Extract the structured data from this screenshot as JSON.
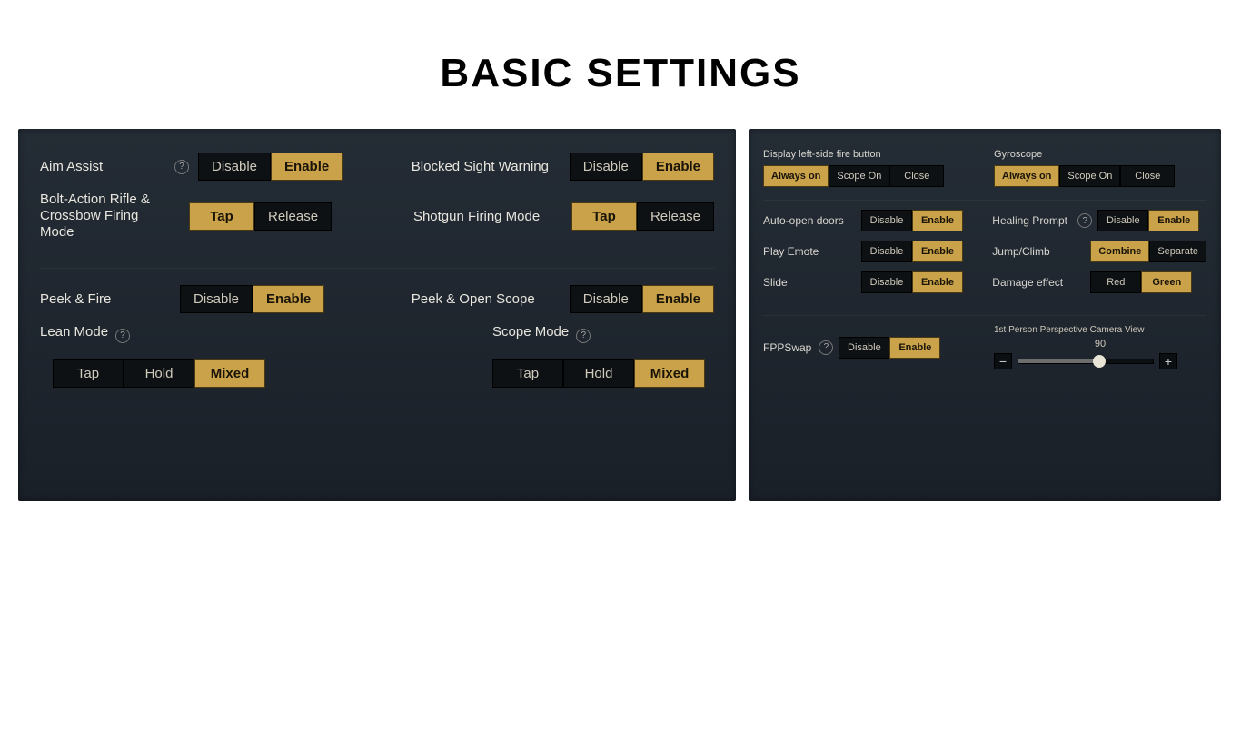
{
  "title": "BASIC SETTINGS",
  "common": {
    "disable": "Disable",
    "enable": "Enable",
    "tap": "Tap",
    "release": "Release",
    "hold": "Hold",
    "mixed": "Mixed",
    "always_on": "Always on",
    "scope_on": "Scope On",
    "close": "Close",
    "combine": "Combine",
    "separate": "Separate",
    "red": "Red",
    "green": "Green",
    "help": "?"
  },
  "left": {
    "aim_assist": {
      "label": "Aim Assist",
      "value": "Enable"
    },
    "blocked_sight": {
      "label": "Blocked Sight Warning",
      "value": "Enable"
    },
    "bolt_crossbow": {
      "label": "Bolt-Action Rifle & Crossbow Firing Mode",
      "value": "Tap"
    },
    "shotgun": {
      "label": "Shotgun Firing Mode",
      "value": "Tap"
    },
    "peek_fire": {
      "label": "Peek & Fire",
      "value": "Enable"
    },
    "peek_scope": {
      "label": "Peek & Open Scope",
      "value": "Enable"
    },
    "lean_mode": {
      "label": "Lean Mode",
      "value": "Mixed"
    },
    "scope_mode": {
      "label": "Scope Mode",
      "value": "Mixed"
    }
  },
  "right": {
    "left_fire": {
      "label": "Display left-side fire button",
      "value": "Always on"
    },
    "gyroscope": {
      "label": "Gyroscope",
      "value": "Always on"
    },
    "auto_open_doors": {
      "label": "Auto-open doors",
      "value": "Enable"
    },
    "healing_prompt": {
      "label": "Healing Prompt",
      "value": "Enable"
    },
    "play_emote": {
      "label": "Play Emote",
      "value": "Enable"
    },
    "jump_climb": {
      "label": "Jump/Climb",
      "value": "Combine"
    },
    "slide": {
      "label": "Slide",
      "value": "Enable"
    },
    "damage_effect": {
      "label": "Damage effect",
      "value": "Green"
    },
    "fpp_swap": {
      "label": "FPPSwap",
      "value": "Enable"
    },
    "fpp_camera": {
      "label": "1st Person Perspective Camera View",
      "value": 90,
      "min": 0,
      "max": 150
    }
  }
}
